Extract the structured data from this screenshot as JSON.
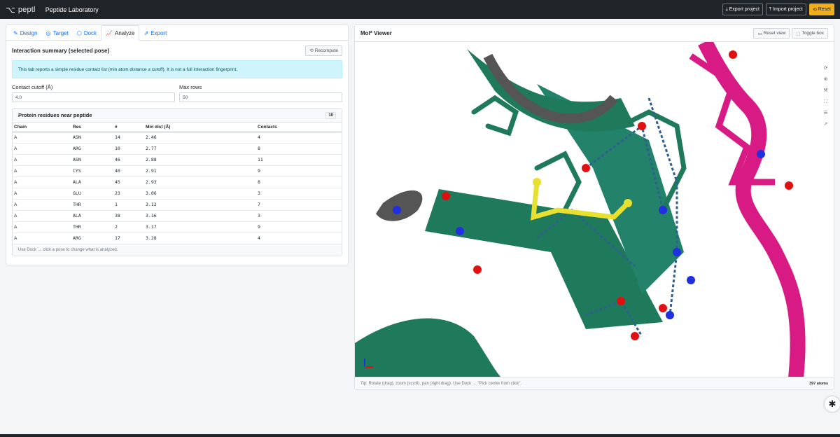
{
  "topbar": {
    "logo_mark": "⌥",
    "app_name": "peptl",
    "title": "Peptide Laboratory",
    "export_label": "Export project",
    "import_label": "Import project",
    "reset_label": "Reset"
  },
  "tabs": [
    {
      "label": "Design",
      "icon": "pencil-icon"
    },
    {
      "label": "Target",
      "icon": "target-icon"
    },
    {
      "label": "Dock",
      "icon": "box-icon"
    },
    {
      "label": "Analyze",
      "icon": "chart-icon"
    },
    {
      "label": "Export",
      "icon": "export-icon"
    }
  ],
  "analyze": {
    "title": "Interaction summary (selected pose)",
    "recompute_label": "Recompute",
    "info": "This tab reports a simple residue contact list (min atom distance ≤ cutoff). It is not a full interaction fingerprint.",
    "cutoff_label": "Contact cutoff (Å)",
    "cutoff_value": "4.0",
    "maxrows_label": "Max rows",
    "maxrows_value": "50",
    "table_title": "Protein residues near peptide",
    "count": "10",
    "columns": [
      "Chain",
      "Res",
      "#",
      "Min dist (Å)",
      "Contacts"
    ],
    "rows": [
      [
        "A",
        "ASN",
        "14",
        "2.46",
        "4"
      ],
      [
        "A",
        "ARG",
        "10",
        "2.77",
        "8"
      ],
      [
        "A",
        "ASN",
        "46",
        "2.88",
        "11"
      ],
      [
        "A",
        "CYS",
        "40",
        "2.91",
        "9"
      ],
      [
        "A",
        "ALA",
        "45",
        "2.93",
        "8"
      ],
      [
        "A",
        "GLU",
        "23",
        "3.06",
        "3"
      ],
      [
        "A",
        "THR",
        "1",
        "3.12",
        "7"
      ],
      [
        "A",
        "ALA",
        "38",
        "3.16",
        "3"
      ],
      [
        "A",
        "THR",
        "2",
        "3.17",
        "9"
      ],
      [
        "A",
        "ARG",
        "17",
        "3.28",
        "4"
      ]
    ],
    "footer": "Use Dock → click a pose to change what is analyzed."
  },
  "viewer": {
    "title": "Mol* Viewer",
    "reset_view_label": "Reset view",
    "toggle_box_label": "Toggle box",
    "tip": "Tip: Rotate (drag), zoom (scroll), pan (right drag). Use Dock → \"Pick center from click\".",
    "atoms": "397 atoms"
  },
  "colors": {
    "protein": "#1f7a5c",
    "peptide": "#d81b84",
    "oxygen": "#e01010",
    "nitrogen": "#2030e0",
    "sulfur": "#e8e030",
    "hbond": "#2f5f8f"
  }
}
